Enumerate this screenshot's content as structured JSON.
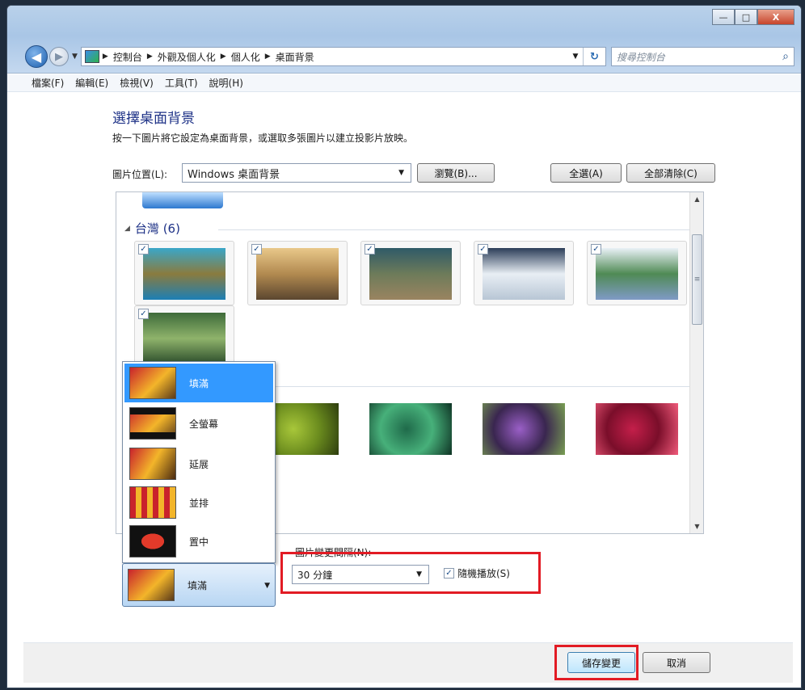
{
  "window": {
    "controls": {
      "minimize": "—",
      "maximize": "□",
      "close": "X"
    }
  },
  "nav": {
    "back": "◀",
    "forward": "▶",
    "breadcrumbs": [
      "控制台",
      "外觀及個人化",
      "個人化",
      "桌面背景"
    ],
    "refresh": "↻",
    "search_placeholder": "搜尋控制台"
  },
  "menubar": [
    "檔案(F)",
    "編輯(E)",
    "檢視(V)",
    "工具(T)",
    "說明(H)"
  ],
  "page": {
    "title": "選擇桌面背景",
    "subtitle": "按一下圖片將它設定為桌面背景，或選取多張圖片以建立投影片放映。",
    "location_label": "圖片位置(L):",
    "location_value": "Windows 桌面背景",
    "browse_button": "瀏覽(B)...",
    "select_all_button": "全選(A)",
    "clear_all_button": "全部清除(C)"
  },
  "gallery": {
    "group": "台灣 (6)",
    "taiwan_images": [
      {
        "checked": true,
        "colors": [
          "#3aa7c9",
          "#8a7b3e",
          "#1c7fb5"
        ]
      },
      {
        "checked": true,
        "colors": [
          "#e9c88a",
          "#b28a50",
          "#5b4630"
        ]
      },
      {
        "checked": true,
        "colors": [
          "#2f5a68",
          "#6d7b5a",
          "#9a8460"
        ]
      },
      {
        "checked": true,
        "colors": [
          "#2b3d58",
          "#e8eef4",
          "#b8c6d5"
        ]
      },
      {
        "checked": true,
        "colors": [
          "#eaf1f7",
          "#4f8a54",
          "#7f9ac6"
        ]
      },
      {
        "checked": true,
        "colors": [
          "#3e6b3a",
          "#8fb36b",
          "#2a4b2a"
        ]
      }
    ],
    "flower_images": [
      {
        "colors": [
          "#a8c73a",
          "#6b8c1e",
          "#2d3d0e"
        ]
      },
      {
        "colors": [
          "#1f6a4a",
          "#47b07a",
          "#0e3324"
        ]
      },
      {
        "colors": [
          "#9a5fc7",
          "#3a2650",
          "#7aa053"
        ]
      },
      {
        "colors": [
          "#c41f4a",
          "#7a0e2a",
          "#f05a7a"
        ]
      }
    ]
  },
  "position": {
    "options": [
      "填滿",
      "全螢幕",
      "延展",
      "並排",
      "置中"
    ],
    "selected": "填滿"
  },
  "slideshow": {
    "interval_label": "圖片變更間隔(N):",
    "interval_value": "30 分鐘",
    "shuffle_label": "隨機播放(S)",
    "shuffle_checked": true
  },
  "buttons": {
    "save": "儲存變更",
    "cancel": "取消"
  },
  "colors": {
    "heading": "#1e3287",
    "highlight_box": "#e21b24",
    "selection": "#3399ff"
  }
}
